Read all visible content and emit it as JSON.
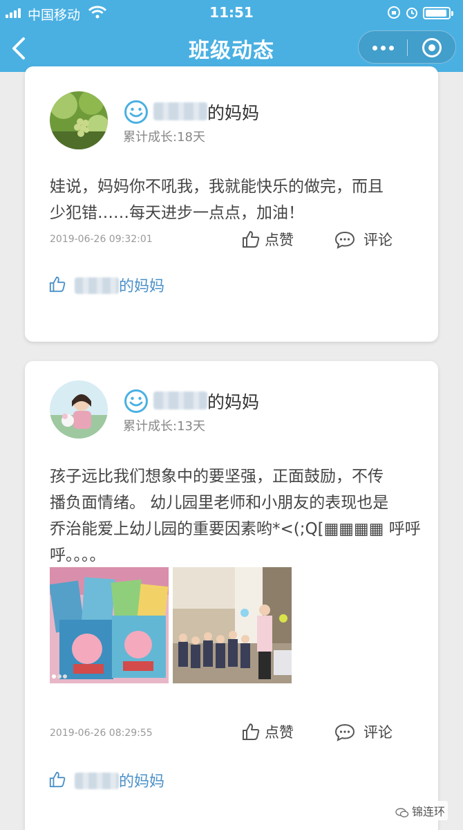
{
  "status_bar": {
    "carrier": "中国移动",
    "time": "11:51"
  },
  "nav": {
    "title": "班级动态"
  },
  "posts": [
    {
      "author_suffix": "的妈妈",
      "growth": "累计成长:18天",
      "text_lines": [
        "娃说，妈妈你不吼我，我就能快乐的做完，而且",
        "少犯错……每天进步一点点，加油！"
      ],
      "date": "2019-06-26 09:32:01",
      "like_label": "点赞",
      "comment_label": "评论",
      "liked_by_suffix": "的妈妈"
    },
    {
      "author_suffix": "的妈妈",
      "growth": "累计成长:13天",
      "text_lines": [
        "孩子远比我们想象中的要坚强，正面鼓励，不传",
        "播负面情绪。 幼儿园里老师和小朋友的表现也是",
        "乔治能爱上幼儿园的重要因素哟*<(;Q[▦▦▦▦ 呼呼",
        "呼。。。。"
      ],
      "date": "2019-06-26 08:29:55",
      "like_label": "点赞",
      "comment_label": "评论",
      "liked_by_suffix": "的妈妈"
    }
  ],
  "watermark": "锦连环",
  "colors": {
    "header": "#4ab0e2",
    "accent": "#4a90c8"
  }
}
